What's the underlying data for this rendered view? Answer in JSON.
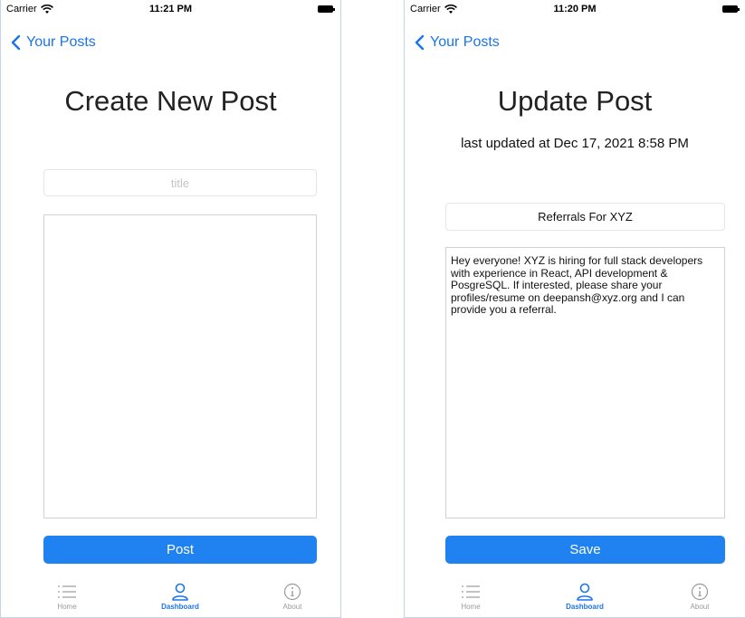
{
  "left_screen": {
    "status_bar": {
      "carrier": "Carrier",
      "time": "11:21 PM"
    },
    "nav": {
      "back_label": "Your Posts"
    },
    "title": "Create New Post",
    "title_field": {
      "value": "",
      "placeholder": "title"
    },
    "body_field": {
      "value": ""
    },
    "primary_button": "Post",
    "tabs": [
      {
        "label": "Home",
        "icon": "list-icon"
      },
      {
        "label": "Dashboard",
        "icon": "person-icon",
        "active": true
      },
      {
        "label": "About",
        "icon": "info-icon"
      }
    ]
  },
  "right_screen": {
    "status_bar": {
      "carrier": "Carrier",
      "time": "11:20 PM"
    },
    "nav": {
      "back_label": "Your Posts"
    },
    "title": "Update Post",
    "subtitle": "last updated at Dec 17, 2021 8:58 PM",
    "title_field": {
      "value": "Referrals For XYZ"
    },
    "body_field": {
      "value": "Hey everyone! XYZ is hiring for full stack developers with experience in React, API development & PosgreSQL. If interested, please share your profiles/resume on deepansh@xyz.org and I can provide you a referral."
    },
    "primary_button": "Save",
    "tabs": [
      {
        "label": "Home",
        "icon": "list-icon"
      },
      {
        "label": "Dashboard",
        "icon": "person-icon",
        "active": true
      },
      {
        "label": "About",
        "icon": "info-icon"
      }
    ]
  },
  "colors": {
    "accent": "#1a75ea",
    "button": "#1f82f0",
    "inactive_tab": "#9a9a9a"
  }
}
